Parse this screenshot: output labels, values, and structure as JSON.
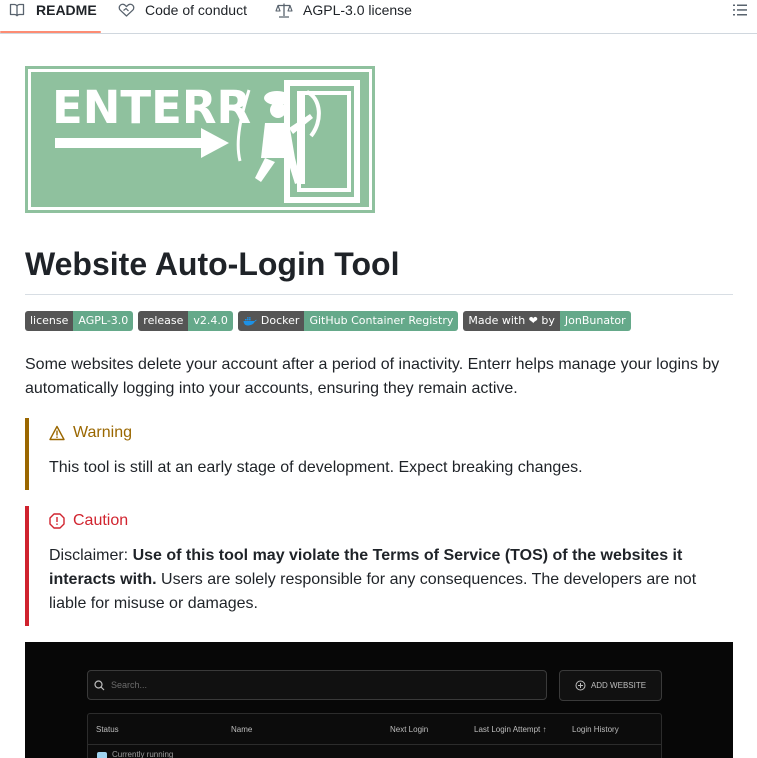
{
  "tabs": {
    "readme": "README",
    "code_of_conduct": "Code of conduct",
    "license": "AGPL-3.0 license"
  },
  "banner": {
    "text": "ENTERR",
    "bg_color": "#8fc19e"
  },
  "title": "Website Auto-Login Tool",
  "badges": [
    {
      "left": "license",
      "right": "AGPL-3.0"
    },
    {
      "left": "release",
      "right": "v2.4.0"
    },
    {
      "left": "Docker",
      "right": "GitHub Container Registry",
      "icon": "docker-icon"
    },
    {
      "left": "Made with ❤ by",
      "right": "JonBunator"
    }
  ],
  "intro": "Some websites delete your account after a period of inactivity. Enterr helps manage your logins by automatically logging into your accounts, ensuring they remain active.",
  "warning": {
    "title": "Warning",
    "body": "This tool is still at an early stage of development. Expect breaking changes."
  },
  "caution": {
    "title": "Caution",
    "body_prefix": "Disclaimer: ",
    "body_bold": "Use of this tool may violate the Terms of Service (TOS) of the websites it interacts with.",
    "body_suffix": " Users are solely responsible for any consequences. The developers are not liable for misuse or damages."
  },
  "screenshot": {
    "search_placeholder": "Search...",
    "add_button": "ADD WEBSITE",
    "columns": [
      "Status",
      "Name",
      "Next Login",
      "Last Login Attempt ↑",
      "Login History"
    ],
    "row_status": "Currently running"
  },
  "colors": {
    "accent_tab": "#fd8c73",
    "warning": "#9a6700",
    "caution": "#cf222e",
    "badge_dark": "#555555",
    "badge_green": "#65a98a"
  }
}
